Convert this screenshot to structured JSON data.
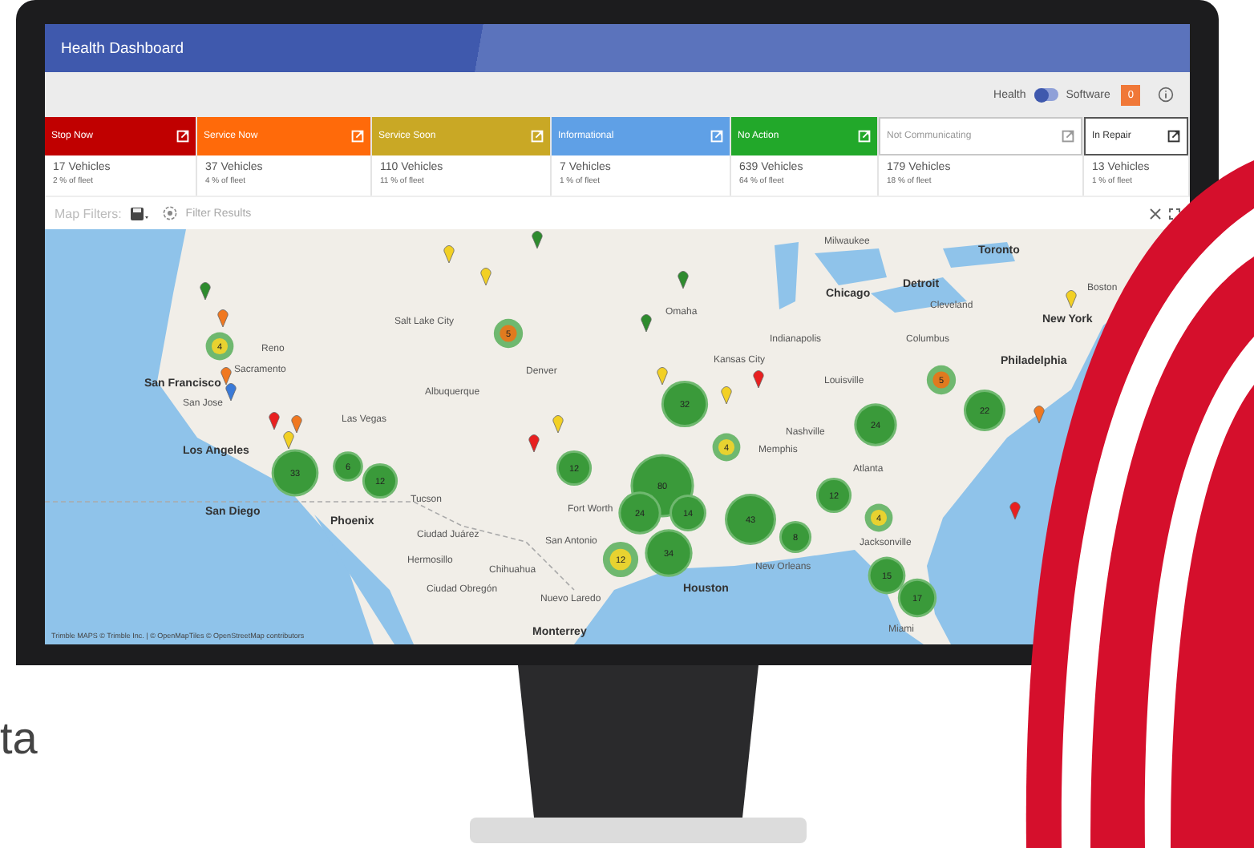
{
  "window": {
    "title": "Health Dashboard"
  },
  "toolbar": {
    "toggle": {
      "left_label": "Health",
      "right_label": "Software",
      "on": false
    },
    "badge": "0"
  },
  "cards": [
    {
      "label": "Stop Now",
      "kind": "filled",
      "color": "#c00000",
      "count": "17 Vehicles",
      "share": "2 % of fleet"
    },
    {
      "label": "Service Now",
      "kind": "filled",
      "color": "#ff6a0a",
      "count": "37 Vehicles",
      "share": "4 % of fleet"
    },
    {
      "label": "Service Soon",
      "kind": "filled",
      "color": "#c9a825",
      "count": "110 Vehicles",
      "share": "11 % of fleet"
    },
    {
      "label": "Informational",
      "kind": "filled",
      "color": "#5fa0e6",
      "count": "7 Vehicles",
      "share": "1 % of fleet"
    },
    {
      "label": "No Action",
      "kind": "filled",
      "color": "#22a82a",
      "count": "639 Vehicles",
      "share": "64 % of fleet"
    },
    {
      "label": "Not Communicating",
      "kind": "outline",
      "color": "#c8c8c8",
      "count": "179 Vehicles",
      "share": "18 % of fleet"
    },
    {
      "label": "In Repair",
      "kind": "outline",
      "color": "#555555",
      "count": "13 Vehicles",
      "share": "1 % of fleet"
    }
  ],
  "filters": {
    "label": "Map Filters:",
    "action": "Filter Results"
  },
  "map": {
    "places": [
      {
        "name": "Toronto",
        "kind": "major"
      },
      {
        "name": "Detroit",
        "kind": "major"
      },
      {
        "name": "Chicago",
        "kind": "major"
      },
      {
        "name": "Cleveland",
        "kind": "minor"
      },
      {
        "name": "Columbus",
        "kind": "minor"
      },
      {
        "name": "New York",
        "kind": "major"
      },
      {
        "name": "Philadelphia",
        "kind": "major"
      },
      {
        "name": "Boston",
        "kind": "minor"
      },
      {
        "name": "Milwaukee",
        "kind": "minor"
      },
      {
        "name": "Omaha",
        "kind": "minor"
      },
      {
        "name": "Kansas City",
        "kind": "minor"
      },
      {
        "name": "Indianapolis",
        "kind": "minor"
      },
      {
        "name": "Nashville",
        "kind": "minor"
      },
      {
        "name": "Louisville",
        "kind": "minor"
      },
      {
        "name": "Atlanta",
        "kind": "minor"
      },
      {
        "name": "Jacksonville",
        "kind": "minor"
      },
      {
        "name": "Miami",
        "kind": "minor"
      },
      {
        "name": "Houston",
        "kind": "major"
      },
      {
        "name": "Denver",
        "kind": "minor"
      },
      {
        "name": "Salt Lake City",
        "kind": "minor"
      },
      {
        "name": "Reno",
        "kind": "minor"
      },
      {
        "name": "Sacramento",
        "kind": "minor"
      },
      {
        "name": "San Francisco",
        "kind": "major"
      },
      {
        "name": "San Jose",
        "kind": "minor"
      },
      {
        "name": "Las Vegas",
        "kind": "minor"
      },
      {
        "name": "Los Angeles",
        "kind": "major"
      },
      {
        "name": "San Diego",
        "kind": "major"
      },
      {
        "name": "Phoenix",
        "kind": "major"
      },
      {
        "name": "Albuquerque",
        "kind": "minor"
      },
      {
        "name": "Tucson",
        "kind": "minor"
      },
      {
        "name": "Ciudad Juárez",
        "kind": "minor"
      },
      {
        "name": "Hermosillo",
        "kind": "minor"
      },
      {
        "name": "Chihuahua",
        "kind": "minor"
      },
      {
        "name": "Ciudad Obregón",
        "kind": "minor"
      },
      {
        "name": "Nuevo Laredo",
        "kind": "minor"
      },
      {
        "name": "Monterrey",
        "kind": "major"
      },
      {
        "name": "Fort Worth",
        "kind": "minor"
      },
      {
        "name": "San Antonio",
        "kind": "minor"
      },
      {
        "name": "Memphis",
        "kind": "minor"
      },
      {
        "name": "New Orleans",
        "kind": "minor"
      }
    ],
    "clusters": [
      {
        "count": "5",
        "color": "#e07a1f"
      },
      {
        "count": "33",
        "color": "#3a9a3a"
      },
      {
        "count": "12",
        "color": "#3a9a3a"
      },
      {
        "count": "6",
        "color": "#3a9a3a"
      },
      {
        "count": "80",
        "color": "#3a9a3a"
      },
      {
        "count": "24",
        "color": "#3a9a3a"
      },
      {
        "count": "14",
        "color": "#3a9a3a"
      },
      {
        "count": "43",
        "color": "#3a9a3a"
      },
      {
        "count": "34",
        "color": "#3a9a3a"
      },
      {
        "count": "12",
        "color": "#e8d230"
      },
      {
        "count": "32",
        "color": "#3a9a3a"
      },
      {
        "count": "22",
        "color": "#3a9a3a"
      },
      {
        "count": "5",
        "color": "#e07a1f"
      },
      {
        "count": "24",
        "color": "#3a9a3a"
      },
      {
        "count": "12",
        "color": "#3a9a3a"
      },
      {
        "count": "17",
        "color": "#3a9a3a"
      },
      {
        "count": "15",
        "color": "#3a9a3a"
      },
      {
        "count": "4",
        "color": "#e8d230"
      },
      {
        "count": "12",
        "color": "#3a9a3a"
      },
      {
        "count": "8",
        "color": "#3a9a3a"
      },
      {
        "count": "4",
        "color": "#e8d230"
      },
      {
        "count": "4",
        "color": "#e8d230"
      }
    ],
    "pins": [
      {
        "color": "#2e8b2e"
      },
      {
        "color": "#f2d024"
      },
      {
        "color": "#f2d024"
      },
      {
        "color": "#2e8b2e"
      },
      {
        "color": "#f07820"
      },
      {
        "color": "#f07820"
      },
      {
        "color": "#3a7ad8"
      },
      {
        "color": "#e82020"
      },
      {
        "color": "#f07820"
      },
      {
        "color": "#f2d024"
      },
      {
        "color": "#e82020"
      },
      {
        "color": "#f2d024"
      },
      {
        "color": "#2e8b2e"
      },
      {
        "color": "#f2d024"
      },
      {
        "color": "#e82020"
      },
      {
        "color": "#f2d024"
      },
      {
        "color": "#2e8b2e"
      },
      {
        "color": "#e82020"
      },
      {
        "color": "#f07820"
      },
      {
        "color": "#f2d024"
      }
    ],
    "attribution": "Trimble MAPS © Trimble Inc. | © OpenMapTiles © OpenStreetMap contributors"
  },
  "caption": "ta"
}
